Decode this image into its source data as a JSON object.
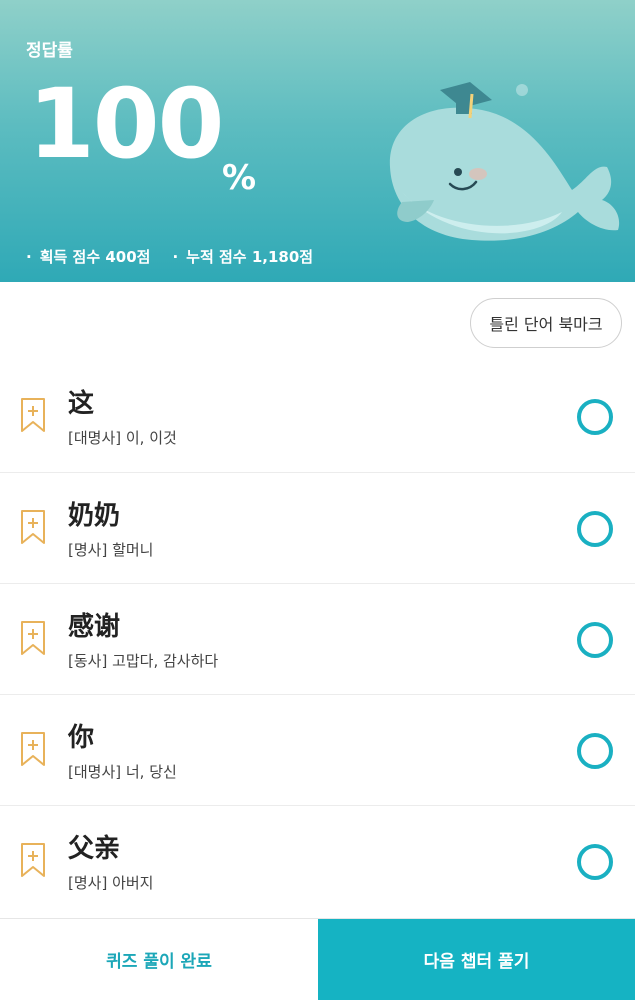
{
  "header": {
    "label": "정답률",
    "score": "100",
    "unit": "%",
    "earned": "획득 점수 400점",
    "total": "누적 점수 1,180점"
  },
  "bookmark_wrong_label": "틀린 단어 북마크",
  "words": [
    {
      "word": "这",
      "meaning": "[대명사] 이, 이것"
    },
    {
      "word": "奶奶",
      "meaning": "[명사] 할머니"
    },
    {
      "word": "感谢",
      "meaning": "[동사] 고맙다, 감사하다"
    },
    {
      "word": "你",
      "meaning": "[대명사] 너, 당신"
    },
    {
      "word": "父亲",
      "meaning": "[명사] 아버지"
    }
  ],
  "footer": {
    "done_label": "퀴즈 풀이 완료",
    "next_label": "다음 챕터 풀기"
  },
  "colors": {
    "accent": "#15b3c3",
    "bookmark": "#e8b25a",
    "correct": "#1ab0c2"
  }
}
